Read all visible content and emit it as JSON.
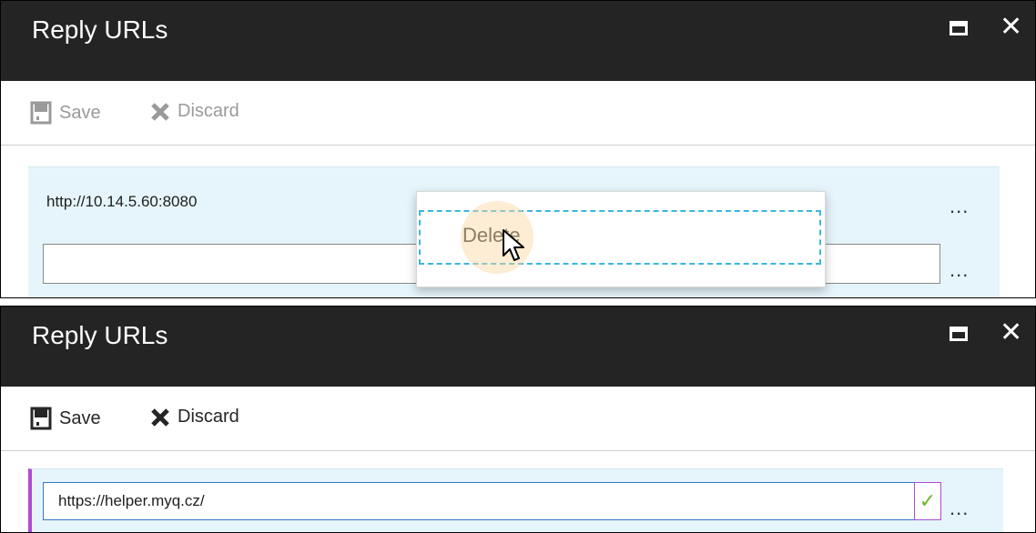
{
  "panels": [
    {
      "title": "Reply URLs",
      "toolbar": {
        "save_label": "Save",
        "discard_label": "Discard",
        "state": "disabled"
      },
      "urls": [
        {
          "value": "http://10.14.5.60:8080"
        }
      ],
      "new_url_input": {
        "value": ""
      },
      "context_menu": {
        "items": [
          {
            "label": "Delete"
          }
        ]
      },
      "ellipsis": "..."
    },
    {
      "title": "Reply URLs",
      "toolbar": {
        "save_label": "Save",
        "discard_label": "Discard",
        "state": "enabled"
      },
      "url_input": {
        "value": "https://helper.myq.cz/",
        "valid": true
      },
      "ellipsis": "..."
    }
  ],
  "icons": {
    "window_maximize": "maximize-icon",
    "window_close": "close-icon",
    "save": "save-icon",
    "discard": "discard-icon",
    "checkmark": "checkmark-icon",
    "more": "ellipsis-icon",
    "cursor": "mouse-cursor-icon"
  },
  "colors": {
    "titlebar_bg": "#242424",
    "row_bg": "#e6f5fb",
    "menu_focus_border": "#3cb6de",
    "input_focus_border": "#2f78c4",
    "modified_accent": "#b04bd3",
    "valid_check": "#6cb62a"
  }
}
